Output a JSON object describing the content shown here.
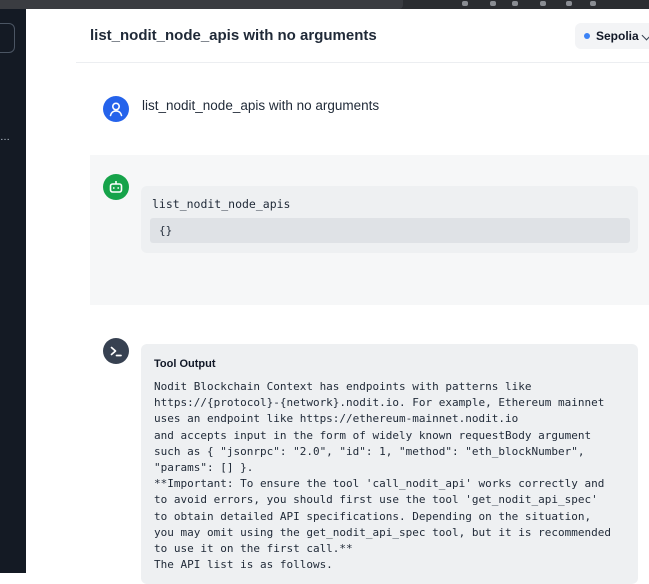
{
  "header": {
    "title": "list_nodit_node_apis with no arguments",
    "network": {
      "label": "Sepolia",
      "dot_color": "#3b82f6"
    }
  },
  "messages": {
    "user": {
      "text": "list_nodit_node_apis with no arguments",
      "avatar_icon": "user-icon",
      "avatar_color": "#2563eb"
    },
    "assistant": {
      "avatar_icon": "bot-icon",
      "avatar_color": "#16a34a",
      "tool_call": {
        "name": "list_nodit_node_apis",
        "args": "{}"
      }
    },
    "tool": {
      "avatar_icon": "terminal-icon",
      "avatar_color": "#374151",
      "title": "Tool Output",
      "lines": [
        "Nodit Blockchain Context has endpoints with patterns like",
        "https://{protocol}-{network}.nodit.io. For example, Ethereum mainnet",
        "uses an endpoint like https://ethereum-mainnet.nodit.io",
        "and accepts input in the form of widely known requestBody argument",
        "such as { \"jsonrpc\": \"2.0\", \"id\": 1, \"method\": \"eth_blockNumber\",",
        "\"params\": [] }.",
        "**Important: To ensure the tool 'call_nodit_api' works correctly and",
        "to avoid errors, you should first use the tool 'get_nodit_api_spec'",
        "to obtain detailed API specifications. Depending on the situation,",
        "you may omit using the get_nodit_api_spec tool, but it is recommended",
        "to use it on the first call.**",
        "The API list is as follows."
      ]
    }
  }
}
